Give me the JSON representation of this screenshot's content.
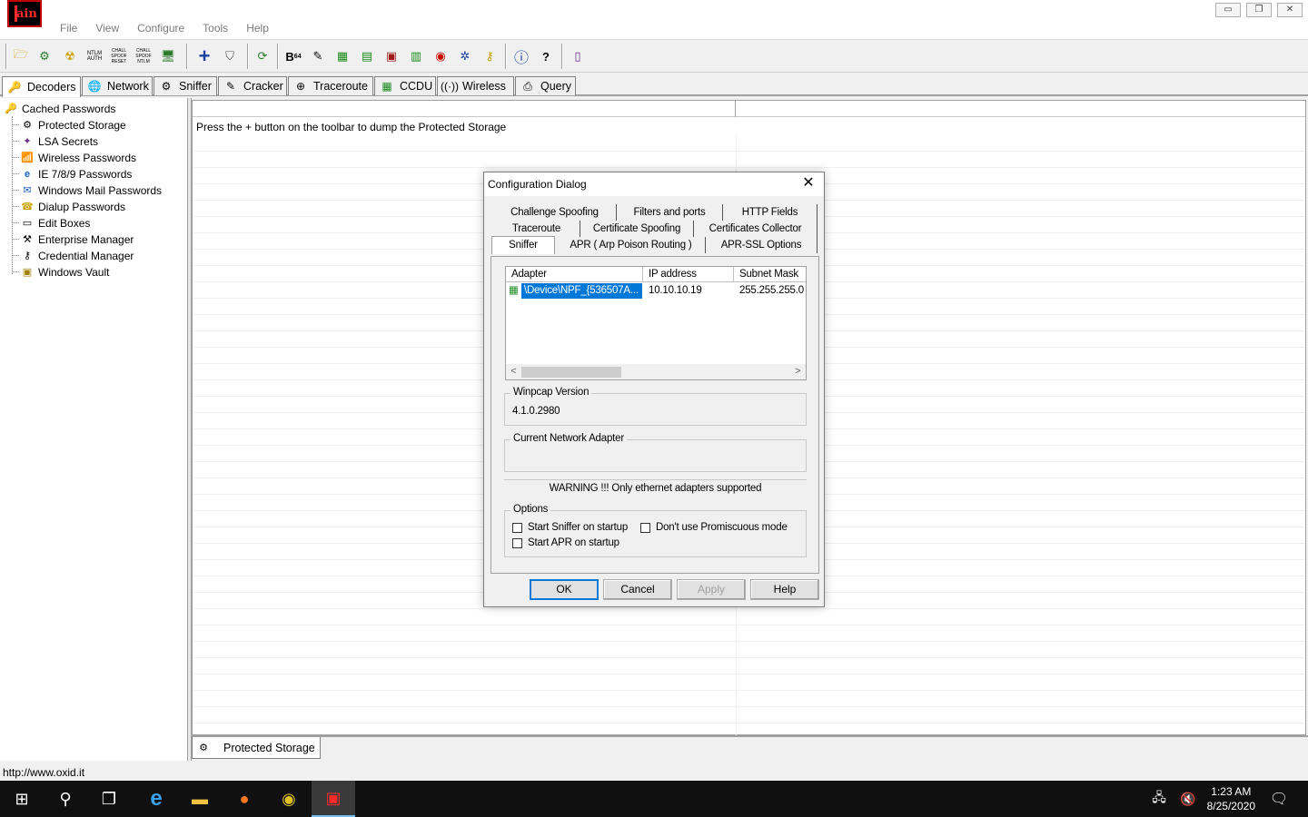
{
  "app": {
    "logo_text": "ain",
    "menu": [
      "File",
      "View",
      "Configure",
      "Tools",
      "Help"
    ],
    "window_controls": [
      "minimize-icon",
      "restore-icon",
      "close-icon"
    ]
  },
  "toolbar": {
    "buttons": [
      "open-icon",
      "add-to-list-icon",
      "radioactive-icon",
      "ntlm-auth-icon",
      "chall-spoof-reset-icon",
      "chall-spoof-ntlm-icon",
      "monitor-icon",
      "plus-icon",
      "shield-icon",
      "refresh-icon",
      "base64-icon",
      "pen-icon",
      "green-card-icon",
      "vpn-icon",
      "pc-icon",
      "terminal-icon",
      "record-icon",
      "routing-icon",
      "key-icon",
      "info-icon",
      "help-icon",
      "exit-icon"
    ],
    "labels": {
      "ntlm1": "NTLM",
      "ntlm1b": "AUTH",
      "chall1": "CHALL",
      "chall1b": "SPOOF",
      "chall1c": "RESET",
      "chall2": "CHALL",
      "chall2b": "SPOOF",
      "chall2c": "NTLM",
      "b64": "B",
      "b64sub": "64"
    }
  },
  "tabs": [
    {
      "label": "Decoders",
      "icon": "decoders-icon"
    },
    {
      "label": "Network",
      "icon": "network-icon"
    },
    {
      "label": "Sniffer",
      "icon": "sniffer-icon"
    },
    {
      "label": "Cracker",
      "icon": "cracker-icon"
    },
    {
      "label": "Traceroute",
      "icon": "traceroute-icon"
    },
    {
      "label": "CCDU",
      "icon": "ccdu-icon"
    },
    {
      "label": "Wireless",
      "icon": "wireless-icon"
    },
    {
      "label": "Query",
      "icon": "query-icon"
    }
  ],
  "tree": {
    "root": "Cached Passwords",
    "items": [
      "Protected Storage",
      "LSA Secrets",
      "Wireless Passwords",
      "IE 7/8/9 Passwords",
      "Windows Mail Passwords",
      "Dialup Passwords",
      "Edit Boxes",
      "Enterprise Manager",
      "Credential Manager",
      "Windows Vault"
    ]
  },
  "list": {
    "message": "Press the + button on the toolbar to dump the Protected Storage"
  },
  "bottom_tab": {
    "label": "Protected Storage"
  },
  "status": {
    "text": "http://www.oxid.it"
  },
  "dialog": {
    "title": "Configuration Dialog",
    "tabs_row1": [
      "Challenge Spoofing",
      "Filters and ports",
      "HTTP Fields"
    ],
    "tabs_row2": [
      "Traceroute",
      "Certificate Spoofing",
      "Certificates Collector"
    ],
    "tabs_row3": [
      "Sniffer",
      "APR ( Arp Poison Routing )",
      "APR-SSL Options"
    ],
    "selected_tab": "Sniffer",
    "adapter_table": {
      "columns": [
        "Adapter",
        "IP address",
        "Subnet Mask"
      ],
      "rows": [
        {
          "adapter": "\\Device\\NPF_{536507A...",
          "ip": "10.10.10.19",
          "mask": "255.255.255.0"
        }
      ]
    },
    "winpcap": {
      "label": "Winpcap Version",
      "value": "4.1.0.2980"
    },
    "current_adapter": {
      "label": "Current Network Adapter",
      "value": ""
    },
    "warning": "WARNING !!! Only ethernet adapters supported",
    "options": {
      "label": "Options",
      "start_sniffer": {
        "label": "Start Sniffer on startup",
        "checked": false
      },
      "no_promisc": {
        "label": "Don't use Promiscuous mode",
        "checked": false
      },
      "start_apr": {
        "label": "Start APR on startup",
        "checked": false
      }
    },
    "buttons": {
      "ok": "OK",
      "cancel": "Cancel",
      "apply": "Apply",
      "help": "Help"
    }
  },
  "taskbar": {
    "time": "1:23 AM",
    "date": "8/25/2020"
  },
  "colors": {
    "selection": "#0078d7",
    "logo_red": "#ff2a2a",
    "taskbar": "#101010"
  }
}
